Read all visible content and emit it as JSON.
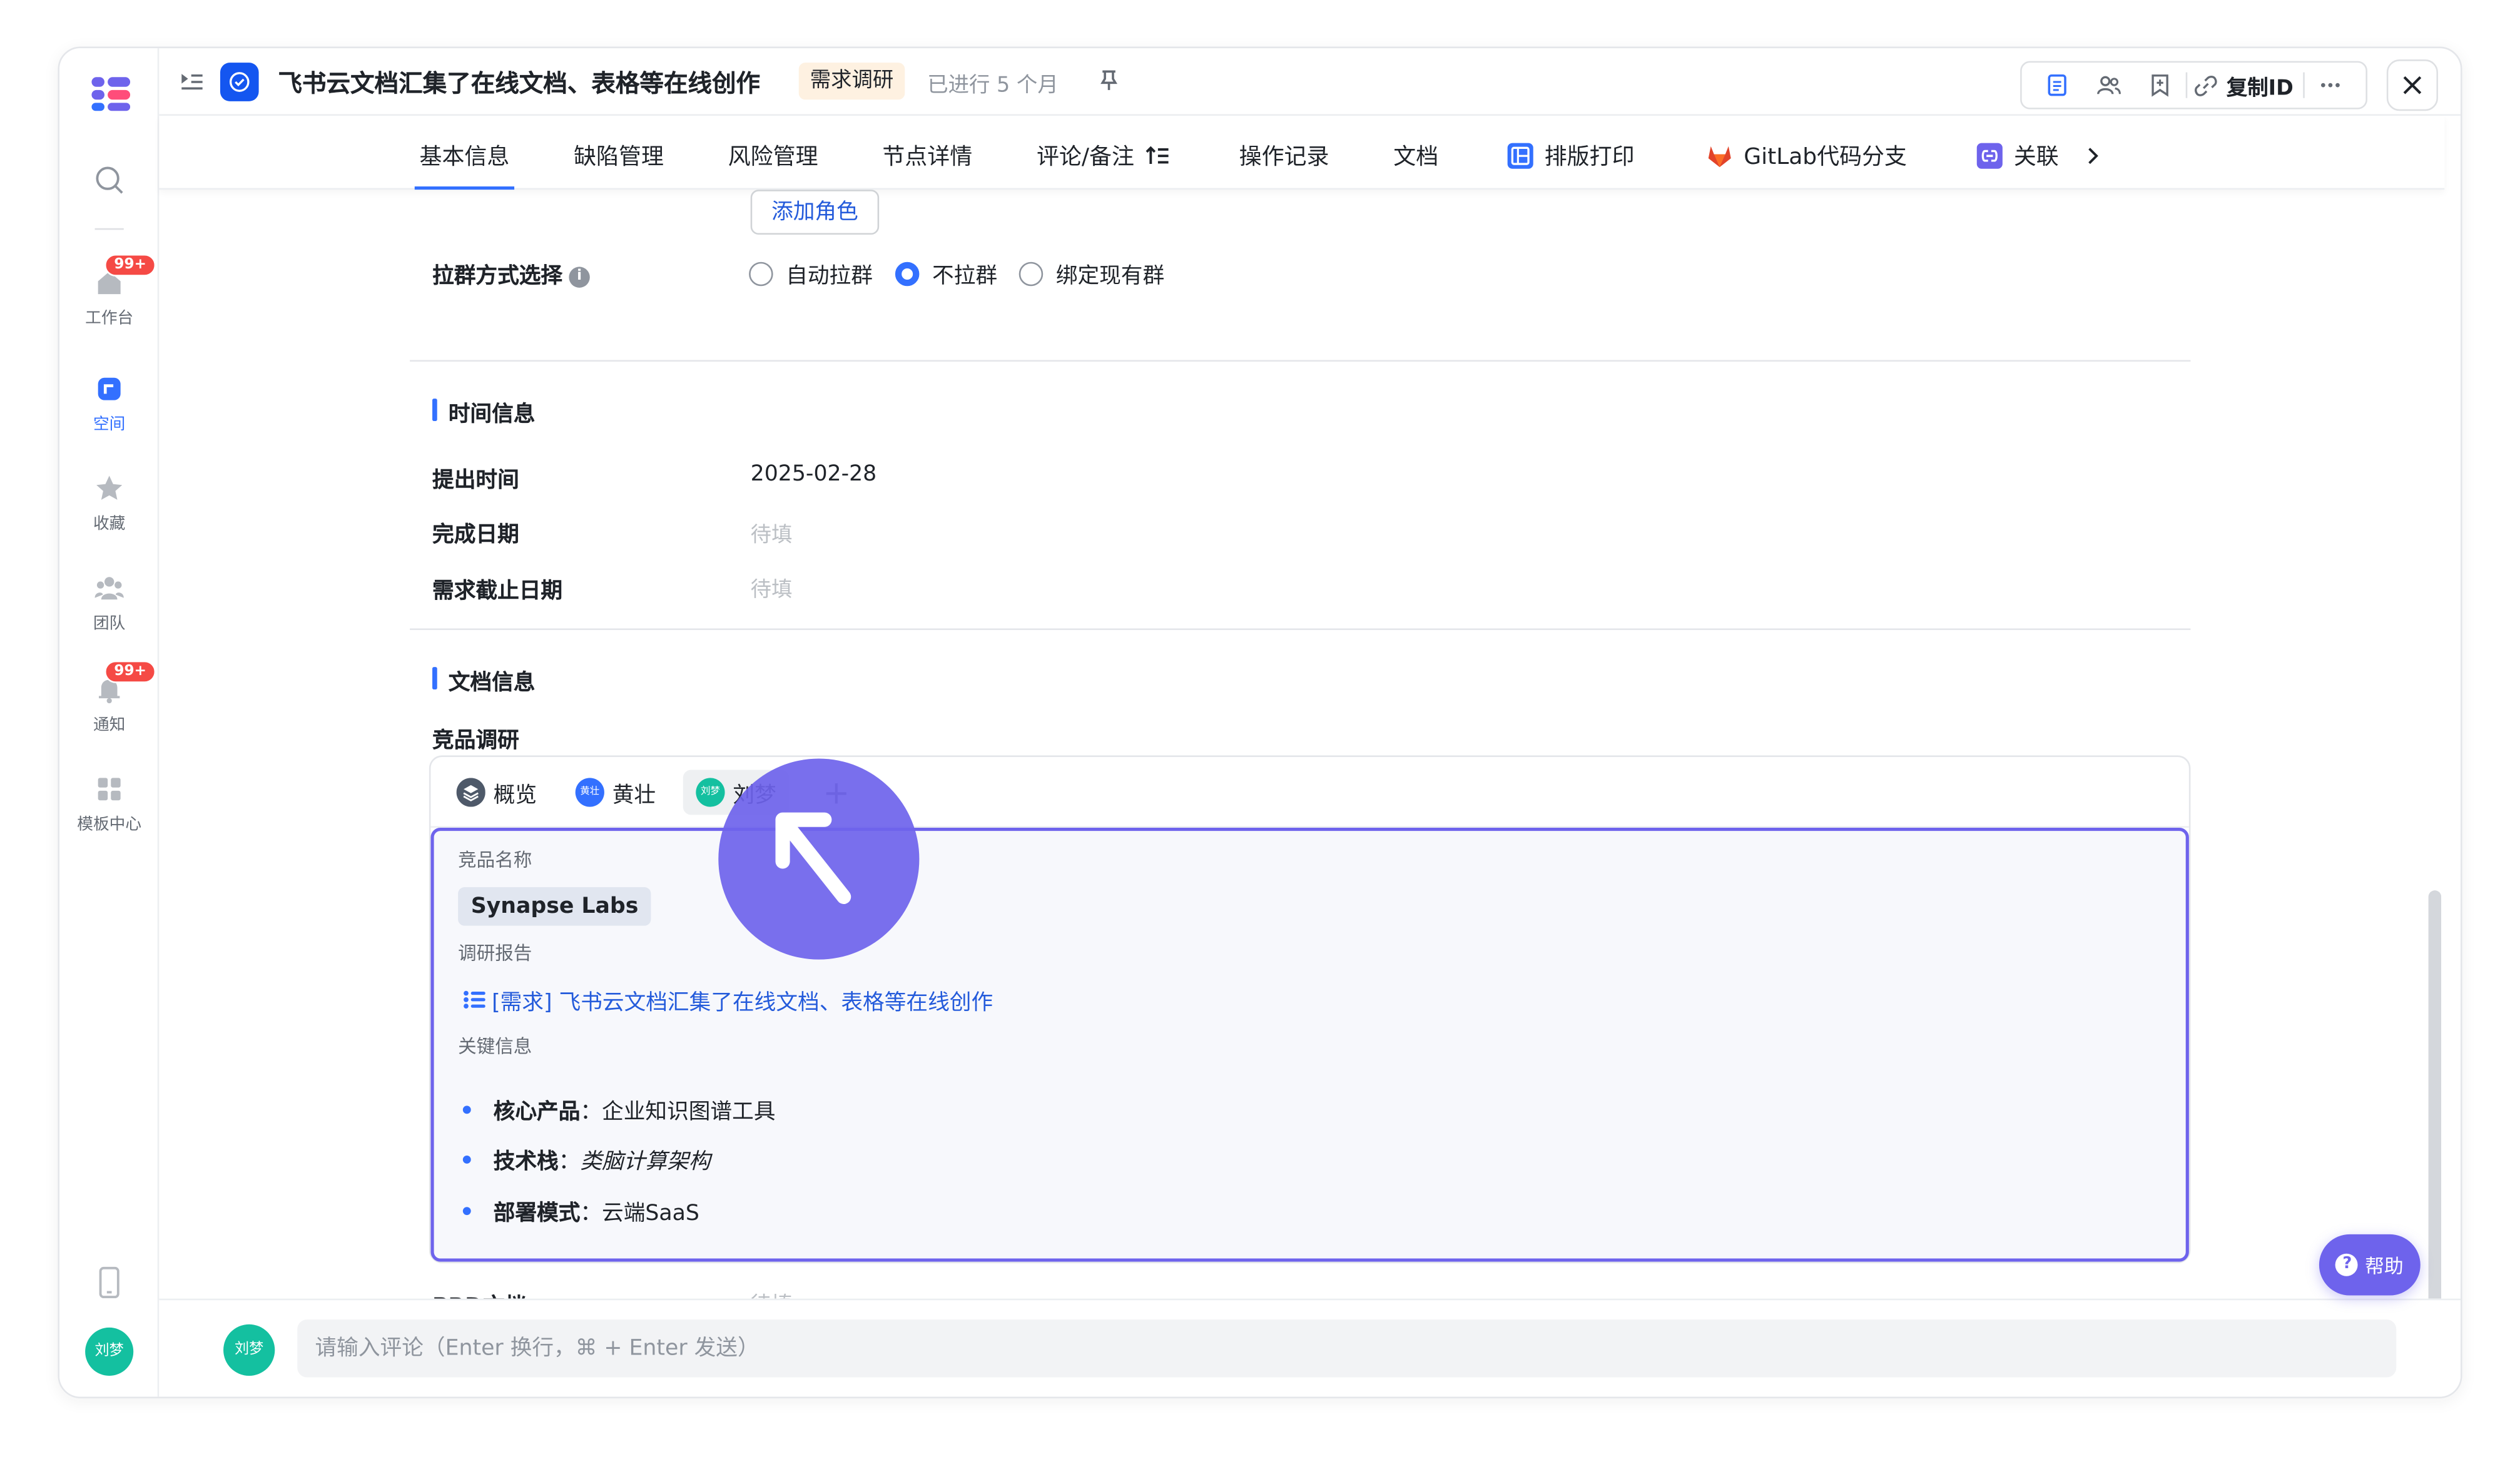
{
  "rail": {
    "items": [
      {
        "label": ""
      },
      {
        "label": "工作台",
        "badge": "99+"
      },
      {
        "label": "空间"
      },
      {
        "label": "收藏"
      },
      {
        "label": "团队"
      },
      {
        "label": "通知",
        "badge": "99+"
      },
      {
        "label": "模板中心"
      }
    ],
    "avatar": "刘梦"
  },
  "header": {
    "title": "飞书云文档汇集了在线文档、表格等在线创作",
    "tag": "需求调研",
    "status": "已进行 5 个月",
    "copy_id": "复制ID"
  },
  "tabs": [
    {
      "label": "基本信息"
    },
    {
      "label": "缺陷管理"
    },
    {
      "label": "风险管理"
    },
    {
      "label": "节点详情"
    },
    {
      "label": "评论/备注"
    },
    {
      "label": "操作记录"
    },
    {
      "label": "文档"
    },
    {
      "label": "排版打印"
    },
    {
      "label": "GitLab代码分支"
    },
    {
      "label": "关联"
    }
  ],
  "basic": {
    "add_role": "添加角色",
    "group_label": "拉群方式选择",
    "group_options": [
      "自动拉群",
      "不拉群",
      "绑定现有群"
    ],
    "group_selected": "不拉群"
  },
  "time_section": {
    "title": "时间信息",
    "fields": [
      {
        "label": "提出时间",
        "value": "2025-02-28"
      },
      {
        "label": "完成日期",
        "value": "待填"
      },
      {
        "label": "需求截止日期",
        "value": "待填"
      }
    ]
  },
  "doc_section": {
    "title": "文档信息",
    "research_label": "竞品调研",
    "card_tabs": [
      {
        "label": "概览",
        "avatar": ""
      },
      {
        "label": "黄壮",
        "avatar": "黄壮",
        "color": "#3370ff"
      },
      {
        "label": "刘梦",
        "avatar": "刘梦",
        "color": "#14c0a0"
      }
    ],
    "add_tab": "+",
    "competitor_name_label": "竞品名称",
    "competitor_name": "Synapse Labs",
    "report_label": "调研报告",
    "report_link": "[需求] 飞书云文档汇集了在线文档、表格等在线创作",
    "key_info_label": "关键信息",
    "key_info": [
      {
        "key": "核心产品",
        "value": "企业知识图谱工具",
        "italic": false
      },
      {
        "key": "技术栈",
        "value": "类脑计算架构",
        "italic": true
      },
      {
        "key": "部署模式",
        "value": "云端SaaS",
        "italic": false
      }
    ],
    "prd_label": "PRD文档",
    "prd_value": "待填"
  },
  "help": {
    "label": "帮助"
  },
  "comment": {
    "avatar": "刘梦",
    "placeholder": "请输入评论（Enter 换行，⌘ + Enter 发送）"
  },
  "colors": {
    "accent": "#3370ff",
    "cursor": "#6e63ec",
    "tag_bg": "#fef1e1"
  }
}
